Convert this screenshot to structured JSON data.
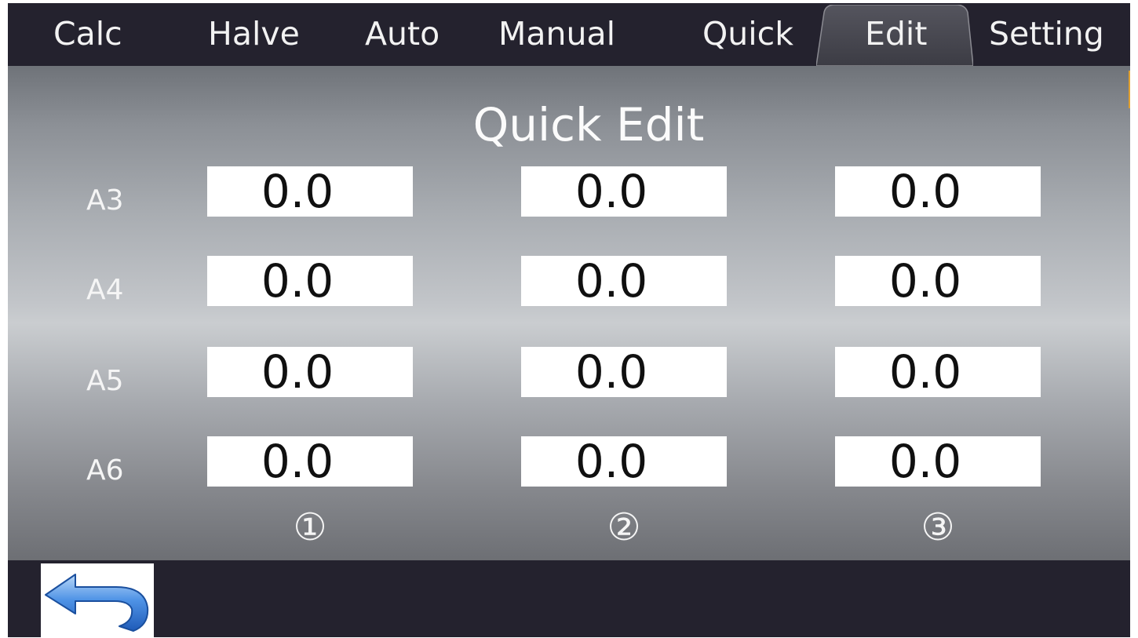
{
  "tabs": [
    {
      "label": "Calc"
    },
    {
      "label": "Halve"
    },
    {
      "label": "Auto"
    },
    {
      "label": "Manual"
    },
    {
      "label": "Quick"
    },
    {
      "label": "Edit",
      "active": true
    },
    {
      "label": "Setting"
    }
  ],
  "panel": {
    "title": "Quick Edit",
    "rows": [
      {
        "label": "A3",
        "values": [
          "0.0",
          "0.0",
          "0.0"
        ]
      },
      {
        "label": "A4",
        "values": [
          "0.0",
          "0.0",
          "0.0"
        ]
      },
      {
        "label": "A5",
        "values": [
          "0.0",
          "0.0",
          "0.0"
        ]
      },
      {
        "label": "A6",
        "values": [
          "0.0",
          "0.0",
          "0.0"
        ]
      }
    ],
    "columns": [
      "①",
      "②",
      "③"
    ]
  },
  "bottom": {
    "back_icon": "back-arrow-icon"
  },
  "colors": {
    "bar_background": "#24222e",
    "active_tab": "#4a4a52",
    "panel_highlight": "#cacdd0",
    "value_box": "#ffffff",
    "back_arrow": "#2f6fd0"
  }
}
